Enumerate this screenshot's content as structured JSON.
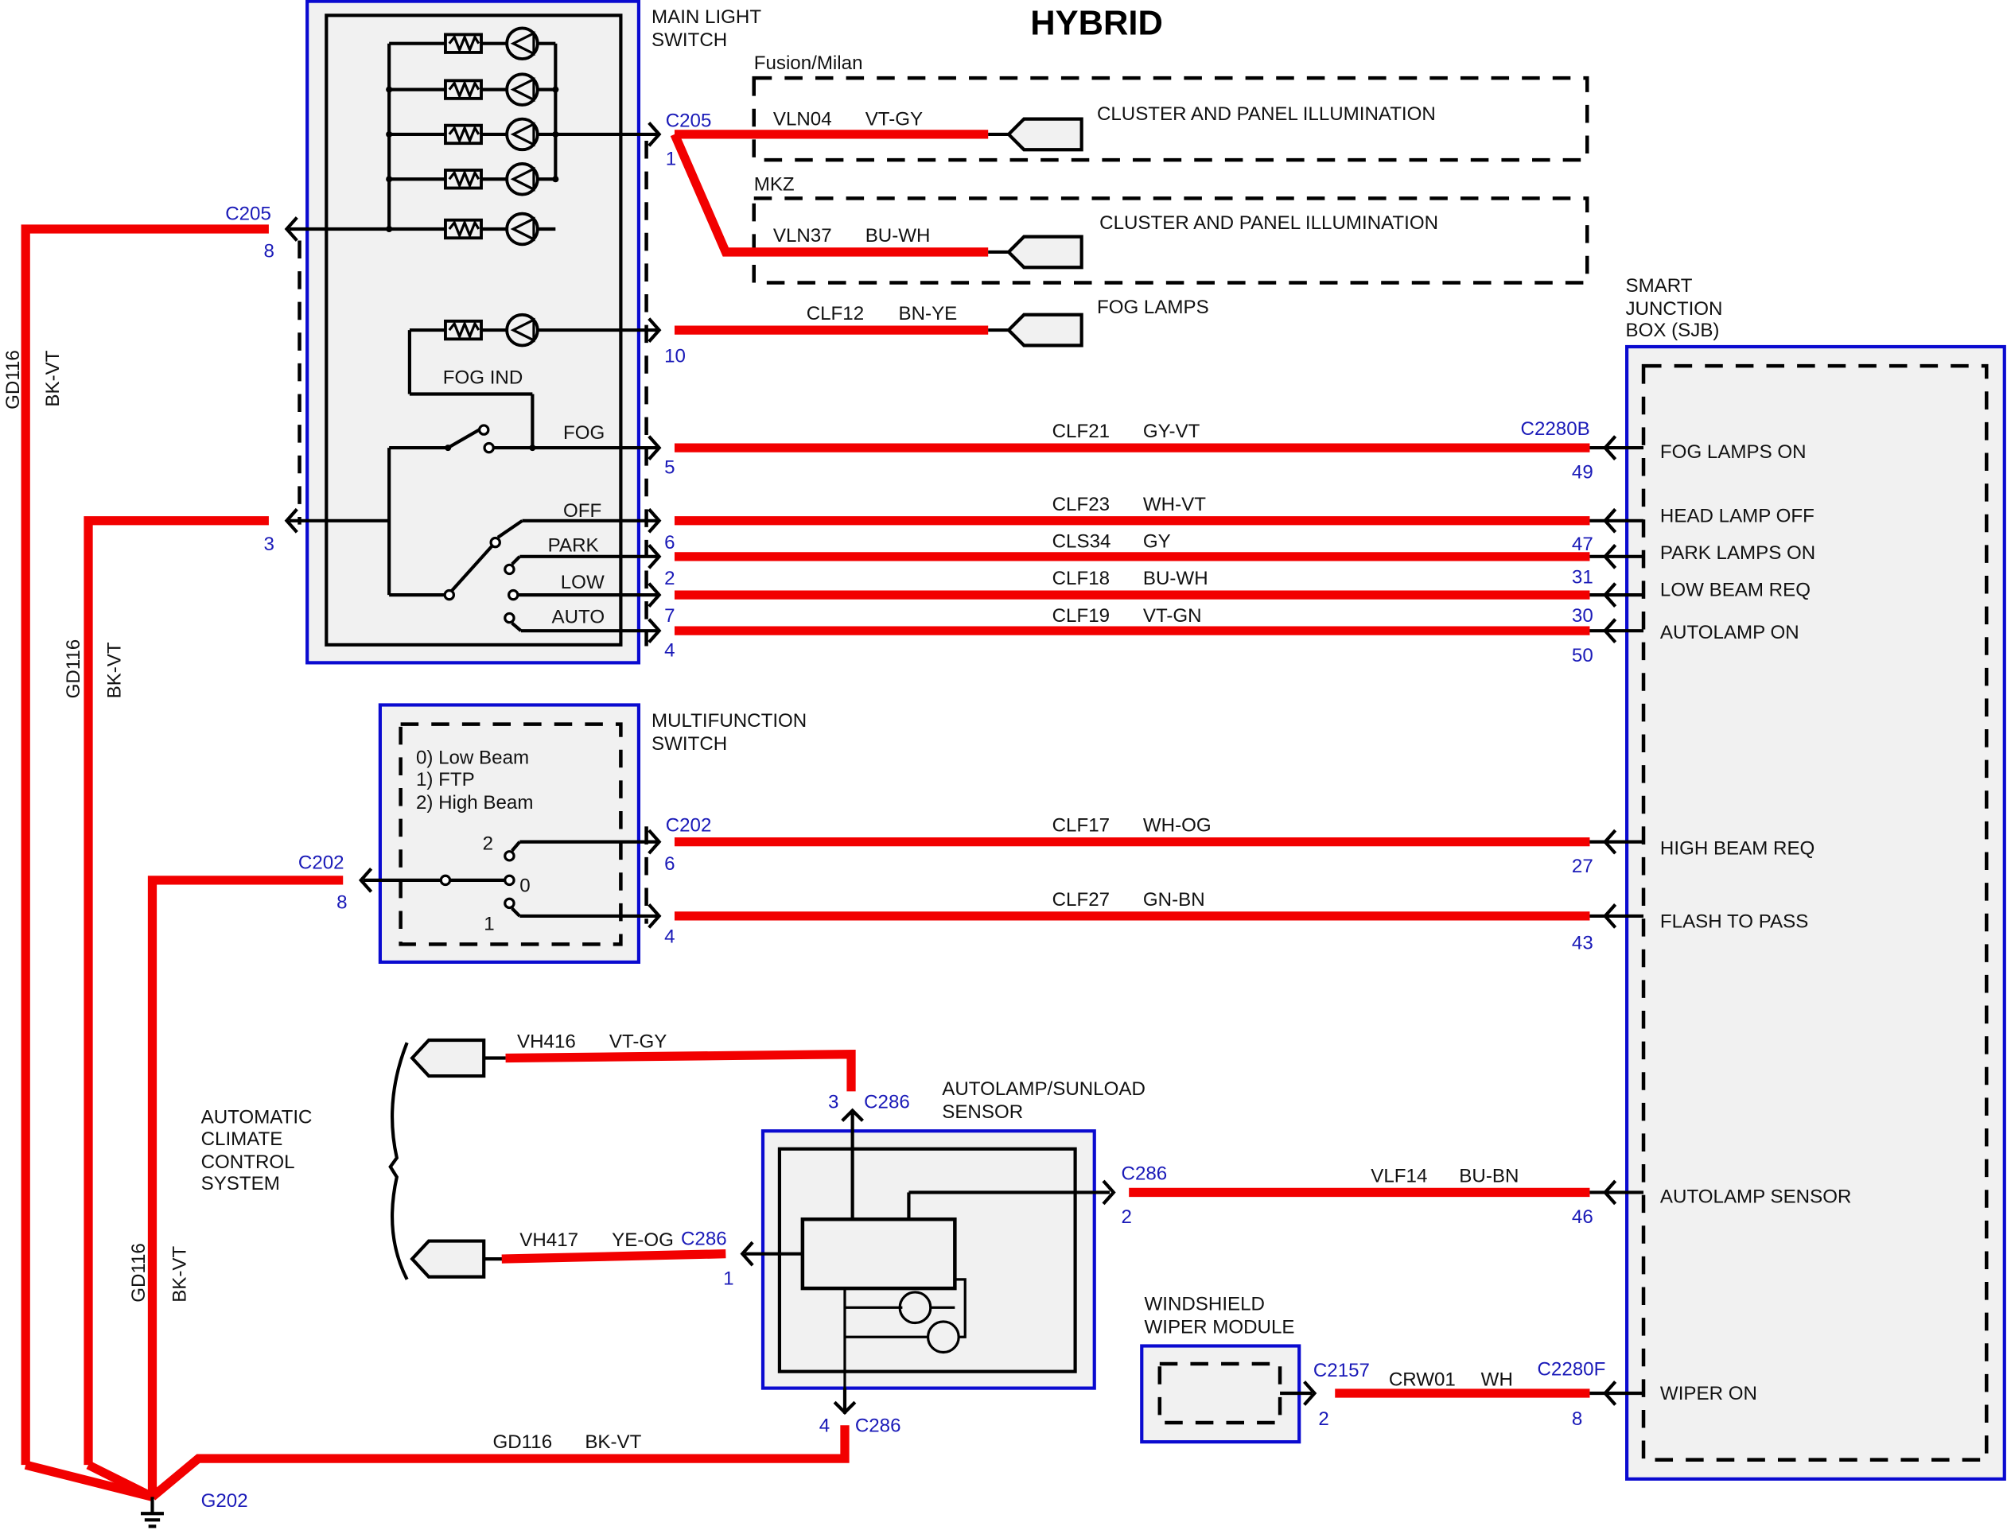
{
  "title": "HYBRID",
  "components": {
    "main_light_switch": {
      "label_lines": [
        "MAIN LIGHT",
        "SWITCH"
      ]
    },
    "multifunction_switch": {
      "label_lines": [
        "MULTIFUNCTION",
        "SWITCH"
      ],
      "positions": [
        "0) Low Beam",
        "1) FTP",
        "2) High Beam"
      ],
      "contacts": [
        "2",
        "0",
        "1"
      ]
    },
    "sjb": {
      "label_lines": [
        "SMART",
        "JUNCTION",
        "BOX (SJB)"
      ]
    },
    "autolamp_sensor": {
      "label_lines": [
        "AUTOLAMP/SUNLOAD",
        "SENSOR"
      ]
    },
    "wiper_module": {
      "label_lines": [
        "WINDSHIELD",
        "WIPER MODULE"
      ]
    },
    "climate": {
      "label_lines": [
        "AUTOMATIC",
        "CLIMATE",
        "CONTROL",
        "SYSTEM"
      ]
    },
    "fog_ind": "FOG IND"
  },
  "switch_positions": [
    "FOG",
    "OFF",
    "PARK",
    "LOW",
    "AUTO"
  ],
  "variants": [
    {
      "name": "Fusion/Milan",
      "circuit": "VLN04",
      "color": "VT-GY",
      "dest": "CLUSTER AND PANEL ILLUMINATION"
    },
    {
      "name": "MKZ",
      "circuit": "VLN37",
      "color": "BU-WH",
      "dest": "CLUSTER AND PANEL ILLUMINATION"
    }
  ],
  "fog_lamps": {
    "circuit": "CLF12",
    "color": "BN-YE",
    "dest": "FOG LAMPS",
    "pin": "10"
  },
  "c205": {
    "connector": "C205",
    "pin_out": "1",
    "pin_ground": "8",
    "pin_ground2": "3"
  },
  "sjb_circuits": [
    {
      "circuit": "CLF21",
      "color": "GY-VT",
      "src_pin": "5",
      "sjb_pin": "49",
      "sjb_conn": "C2280B",
      "function": "FOG LAMPS ON"
    },
    {
      "circuit": "CLF23",
      "color": "WH-VT",
      "src_pin": "6",
      "sjb_pin": "47",
      "function": "HEAD LAMP OFF"
    },
    {
      "circuit": "CLS34",
      "color": "GY",
      "src_pin": "2",
      "sjb_pin": "31",
      "function": "PARK LAMPS ON"
    },
    {
      "circuit": "CLF18",
      "color": "BU-WH",
      "src_pin": "7",
      "sjb_pin": "30",
      "function": "LOW BEAM REQ"
    },
    {
      "circuit": "CLF19",
      "color": "VT-GN",
      "src_pin": "4",
      "sjb_pin": "50",
      "function": "AUTOLAMP ON"
    },
    {
      "circuit": "CLF17",
      "color": "WH-OG",
      "src_pin": "6",
      "sjb_pin": "27",
      "src_conn": "C202",
      "function": "HIGH BEAM REQ"
    },
    {
      "circuit": "CLF27",
      "color": "GN-BN",
      "src_pin": "4",
      "sjb_pin": "43",
      "function": "FLASH TO PASS"
    },
    {
      "circuit": "VLF14",
      "color": "BU-BN",
      "src_pin": "2",
      "sjb_pin": "46",
      "src_conn": "C286",
      "function": "AUTOLAMP SENSOR"
    },
    {
      "circuit": "CRW01",
      "color": "WH",
      "src_pin": "2",
      "sjb_pin": "8",
      "src_conn": "C2157",
      "sjb_conn": "C2280F",
      "function": "WIPER ON"
    }
  ],
  "c202": {
    "connector": "C202",
    "pin": "8"
  },
  "climate_wires": [
    {
      "circuit": "VH416",
      "color": "VT-GY",
      "conn": "C286",
      "pin": "3"
    },
    {
      "circuit": "VH417",
      "color": "YE-OG",
      "conn": "C286",
      "pin": "1"
    }
  ],
  "sensor_ground": {
    "conn": "C286",
    "pin": "4",
    "circuit": "GD116",
    "color": "BK-VT"
  },
  "ground": {
    "circuit": "GD116",
    "color": "BK-VT",
    "point": "G202"
  }
}
